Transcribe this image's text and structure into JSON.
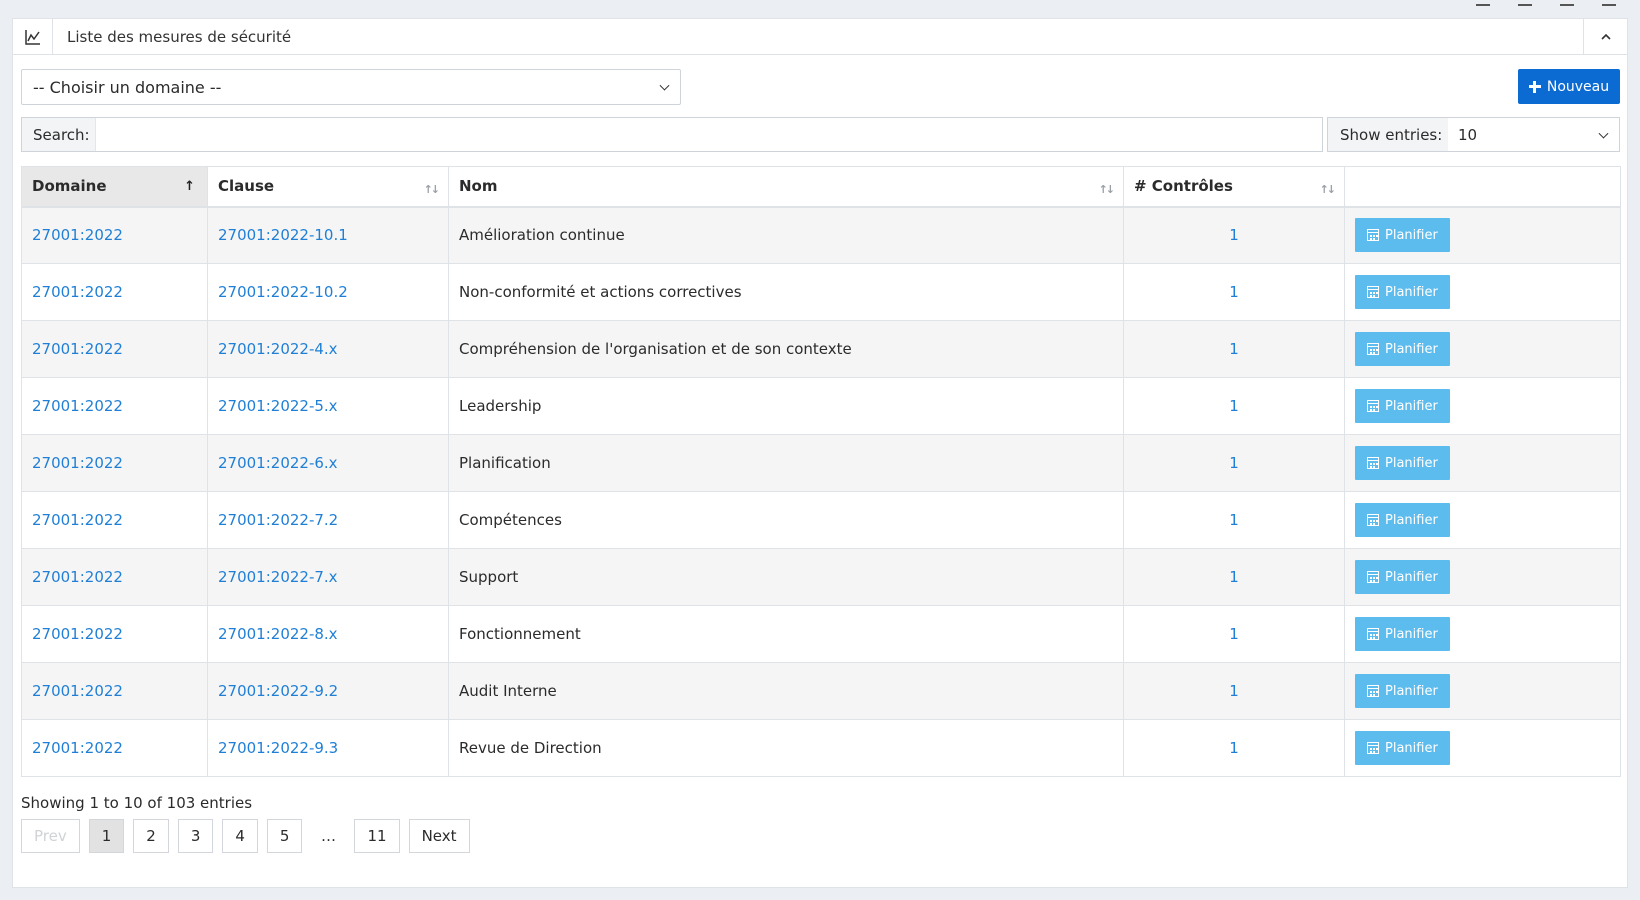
{
  "header": {
    "title": "Liste des mesures de sécurité"
  },
  "toolbar": {
    "domain_select_value": "-- Choisir un domaine --",
    "new_button_label": "Nouveau",
    "search_label": "Search:",
    "search_value": "",
    "entries_label": "Show entries:",
    "entries_value": "10"
  },
  "table": {
    "columns": [
      "Domaine",
      "Clause",
      "Nom",
      "# Contrôles",
      ""
    ],
    "rows": [
      {
        "domaine": "27001:2022",
        "clause": "27001:2022-10.1",
        "nom": "Amélioration continue",
        "controles": "1",
        "action": "Planifier"
      },
      {
        "domaine": "27001:2022",
        "clause": "27001:2022-10.2",
        "nom": "Non-conformité et actions correctives",
        "controles": "1",
        "action": "Planifier"
      },
      {
        "domaine": "27001:2022",
        "clause": "27001:2022-4.x",
        "nom": "Compréhension de l'organisation et de son contexte",
        "controles": "1",
        "action": "Planifier"
      },
      {
        "domaine": "27001:2022",
        "clause": "27001:2022-5.x",
        "nom": "Leadership",
        "controles": "1",
        "action": "Planifier"
      },
      {
        "domaine": "27001:2022",
        "clause": "27001:2022-6.x",
        "nom": "Planification",
        "controles": "1",
        "action": "Planifier"
      },
      {
        "domaine": "27001:2022",
        "clause": "27001:2022-7.2",
        "nom": "Compétences",
        "controles": "1",
        "action": "Planifier"
      },
      {
        "domaine": "27001:2022",
        "clause": "27001:2022-7.x",
        "nom": "Support",
        "controles": "1",
        "action": "Planifier"
      },
      {
        "domaine": "27001:2022",
        "clause": "27001:2022-8.x",
        "nom": "Fonctionnement",
        "controles": "1",
        "action": "Planifier"
      },
      {
        "domaine": "27001:2022",
        "clause": "27001:2022-9.2",
        "nom": "Audit Interne",
        "controles": "1",
        "action": "Planifier"
      },
      {
        "domaine": "27001:2022",
        "clause": "27001:2022-9.3",
        "nom": "Revue de Direction",
        "controles": "1",
        "action": "Planifier"
      }
    ]
  },
  "footer": {
    "info": "Showing 1 to 10 of 103 entries",
    "pagination": [
      "Prev",
      "1",
      "2",
      "3",
      "4",
      "5",
      "…",
      "11",
      "Next"
    ]
  },
  "colors": {
    "accent": "#0b6bd3",
    "link": "#1f7fd6",
    "plan_button": "#5cbcee"
  }
}
